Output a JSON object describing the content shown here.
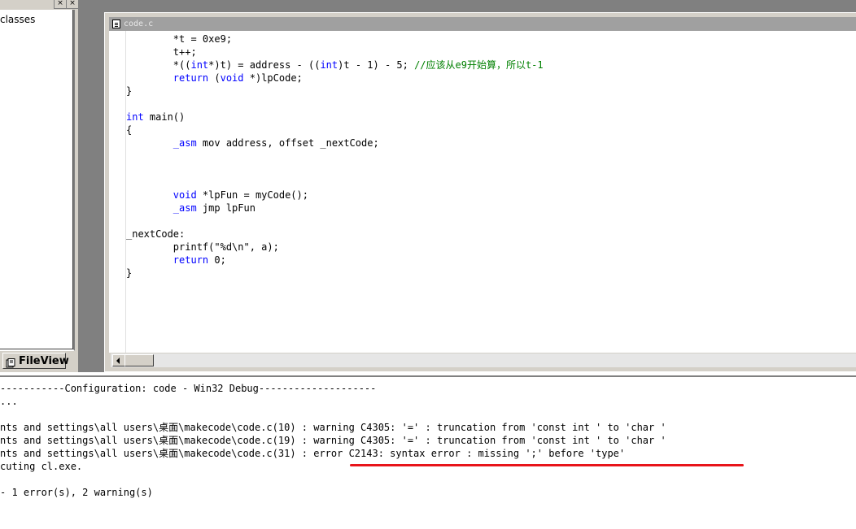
{
  "workspace": {
    "tree_item": "classes",
    "fileview_tab": "FileView",
    "top_btn_1": "×",
    "top_btn_2": "×"
  },
  "editor": {
    "title": "code.c",
    "lines": [
      [
        {
          "t": "        *t = 0xe9;"
        }
      ],
      [
        {
          "t": "        t++;"
        }
      ],
      [
        {
          "t": "        *(("
        },
        {
          "t": "int",
          "c": "kw"
        },
        {
          "t": "*)t) = address - (("
        },
        {
          "t": "int",
          "c": "kw"
        },
        {
          "t": ")t - 1) - 5; "
        },
        {
          "t": "//应该从e9开始算，所以t-1",
          "c": "cm"
        }
      ],
      [
        {
          "t": "        "
        },
        {
          "t": "return",
          "c": "kw"
        },
        {
          "t": " ("
        },
        {
          "t": "void",
          "c": "kw"
        },
        {
          "t": " *)lpCode;"
        }
      ],
      [
        {
          "t": "}"
        }
      ],
      [
        {
          "t": ""
        }
      ],
      [
        {
          "t": "int",
          "c": "kw"
        },
        {
          "t": " main()"
        }
      ],
      [
        {
          "t": "{"
        }
      ],
      [
        {
          "t": "        "
        },
        {
          "t": "_asm",
          "c": "kw"
        },
        {
          "t": " mov address, offset _nextCode;"
        }
      ],
      [
        {
          "t": ""
        }
      ],
      [
        {
          "t": ""
        }
      ],
      [
        {
          "t": ""
        }
      ],
      [
        {
          "t": "        "
        },
        {
          "t": "void",
          "c": "kw"
        },
        {
          "t": " *lpFun = myCode();"
        }
      ],
      [
        {
          "t": "        "
        },
        {
          "t": "_asm",
          "c": "kw"
        },
        {
          "t": " jmp lpFun"
        }
      ],
      [
        {
          "t": ""
        }
      ],
      [
        {
          "t": "_nextCode:"
        }
      ],
      [
        {
          "t": "        printf(\"%d\\n\", a);"
        }
      ],
      [
        {
          "t": "        "
        },
        {
          "t": "return",
          "c": "kw"
        },
        {
          "t": " 0;"
        }
      ],
      [
        {
          "t": "}"
        }
      ]
    ]
  },
  "output": {
    "lines": [
      "-----------Configuration: code - Win32 Debug--------------------",
      "...",
      "",
      "nts and settings\\all users\\桌面\\makecode\\code.c(10) : warning C4305: '=' : truncation from 'const int ' to 'char '",
      "nts and settings\\all users\\桌面\\makecode\\code.c(19) : warning C4305: '=' : truncation from 'const int ' to 'char '",
      "nts and settings\\all users\\桌面\\makecode\\code.c(31) : error C2143: syntax error : missing ';' before 'type'",
      "cuting cl.exe.",
      "",
      "- 1 error(s), 2 warning(s)"
    ]
  },
  "colors": {
    "keyword": "#0000ff",
    "comment": "#008000",
    "error_underline": "#e8141a"
  }
}
